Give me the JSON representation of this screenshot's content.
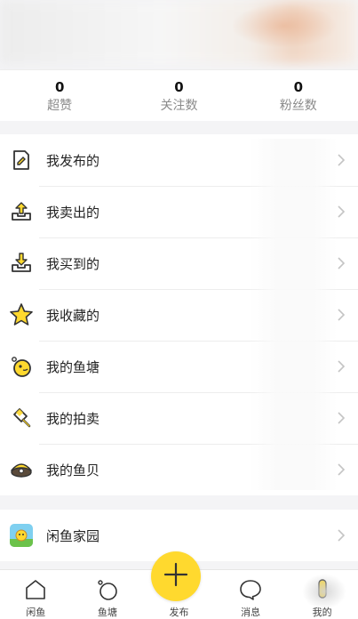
{
  "stats": [
    {
      "value": "0",
      "label": "超赞"
    },
    {
      "value": "0",
      "label": "关注数"
    },
    {
      "value": "0",
      "label": "粉丝数"
    }
  ],
  "menu": [
    {
      "label": "我发布的",
      "icon": "document-pen-icon"
    },
    {
      "label": "我卖出的",
      "icon": "upload-tray-icon"
    },
    {
      "label": "我买到的",
      "icon": "download-tray-icon"
    },
    {
      "label": "我收藏的",
      "icon": "star-icon"
    },
    {
      "label": "我的鱼塘",
      "icon": "fish-pond-icon"
    },
    {
      "label": "我的拍卖",
      "icon": "auction-hammer-icon"
    },
    {
      "label": "我的鱼贝",
      "icon": "shell-icon"
    }
  ],
  "extra_menu": {
    "label": "闲鱼家园",
    "icon": "xianyu-home-icon"
  },
  "tabbar": [
    {
      "label": "闲鱼",
      "icon": "home-icon"
    },
    {
      "label": "鱼塘",
      "icon": "fish-pond-tab-icon"
    },
    {
      "label": "发布",
      "icon": "plus-icon"
    },
    {
      "label": "消息",
      "icon": "message-icon"
    },
    {
      "label": "我的",
      "icon": "profile-icon"
    }
  ],
  "colors": {
    "accent": "#ffd92e",
    "background": "#f4f4f6"
  }
}
